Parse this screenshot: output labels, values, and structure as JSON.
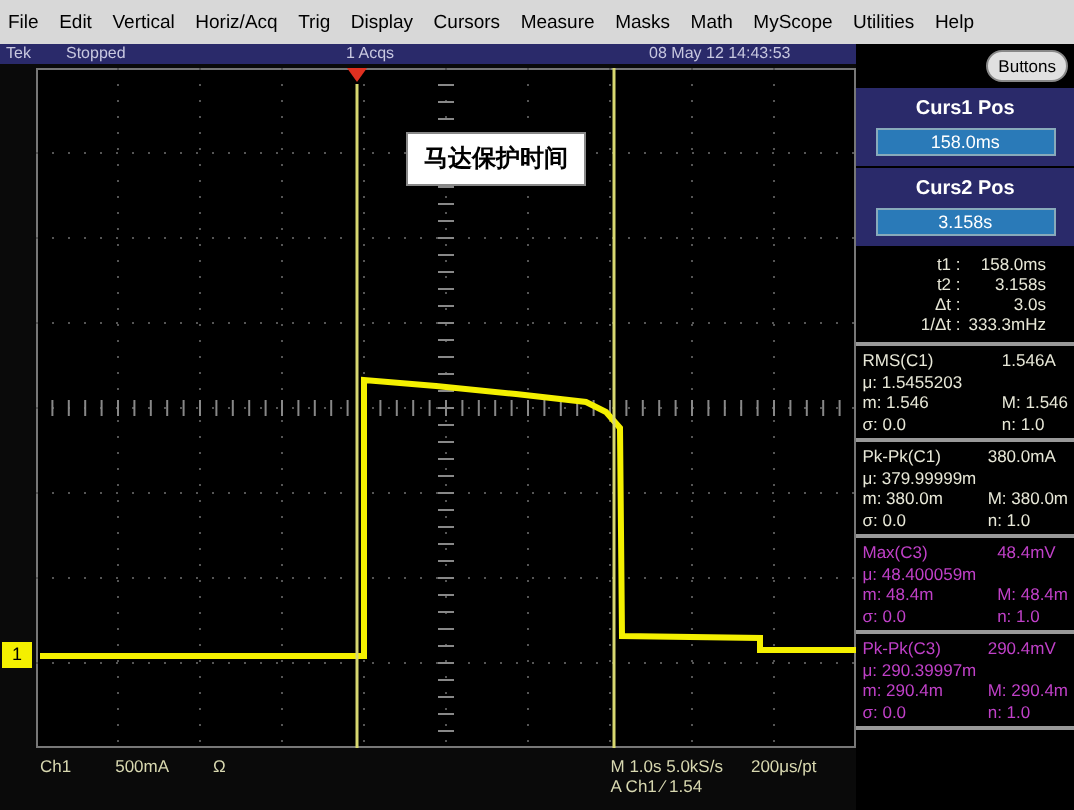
{
  "menu": [
    "File",
    "Edit",
    "Vertical",
    "Horiz/Acq",
    "Trig",
    "Display",
    "Cursors",
    "Measure",
    "Masks",
    "Math",
    "MyScope",
    "Utilities",
    "Help"
  ],
  "status_bar": {
    "brand": "Tek",
    "state": "Stopped",
    "acqs": "1 Acqs",
    "datetime": "08 May 12 14:43:53"
  },
  "annotation": "马达保护时间",
  "channel_marker": "1",
  "readout": {
    "channel": "Ch1",
    "scale": "500mA",
    "impedance": "Ω",
    "timebase": "M 1.0s 5.0kS/s",
    "resolution": "200μs/pt",
    "trigger": "A Ch1 ⁄ 1.54"
  },
  "side_panel": {
    "button": "Buttons",
    "cursors": [
      {
        "title": "Curs1 Pos",
        "value": "158.0ms"
      },
      {
        "title": "Curs2 Pos",
        "value": "3.158s"
      }
    ],
    "cursor_readouts": [
      {
        "label": "t1 :",
        "value": "158.0ms"
      },
      {
        "label": "t2 :",
        "value": "3.158s"
      },
      {
        "label": "Δt :",
        "value": "3.0s"
      },
      {
        "label": "1/Δt :",
        "value": "333.3mHz"
      }
    ],
    "measurements": [
      {
        "name": "RMS(C1)",
        "value": "1.546A",
        "mean": "μ: 1.5455203",
        "min": "m: 1.546",
        "max": "M: 1.546",
        "sigma": "σ: 0.0",
        "n": "n: 1.0",
        "color": "#e8e8d8"
      },
      {
        "name": "Pk-Pk(C1)",
        "value": "380.0mA",
        "mean": "μ: 379.99999m",
        "min": "m: 380.0m",
        "max": "M: 380.0m",
        "sigma": "σ: 0.0",
        "n": "n: 1.0",
        "color": "#e8e8d8"
      },
      {
        "name": "Max(C3)",
        "value": "48.4mV",
        "mean": "μ: 48.400059m",
        "min": "m: 48.4m",
        "max": "M: 48.4m",
        "sigma": "σ: 0.0",
        "n": "n: 1.0",
        "color": "#c040c8"
      },
      {
        "name": "Pk-Pk(C3)",
        "value": "290.4mV",
        "mean": "μ: 290.39997m",
        "min": "m: 290.4m",
        "max": "M: 290.4m",
        "sigma": "σ: 0.0",
        "n": "n: 1.0",
        "color": "#c040c8"
      }
    ]
  }
}
